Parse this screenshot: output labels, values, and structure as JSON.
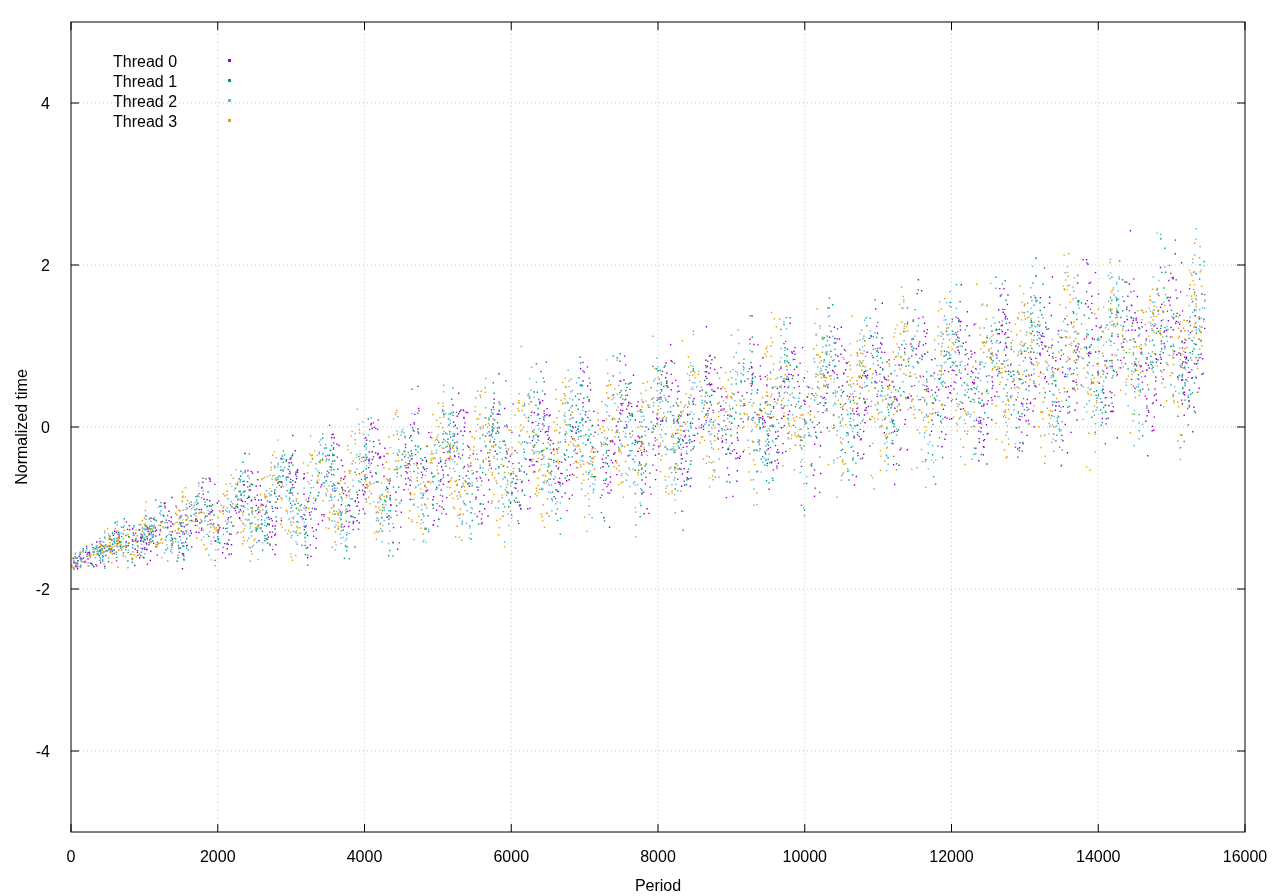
{
  "plot": {
    "x_axis": {
      "title": "Period",
      "ticks": [
        "0",
        "2000",
        "4000",
        "6000",
        "8000",
        "10000",
        "12000",
        "14000",
        "16000"
      ]
    },
    "y_axis": {
      "title": "Normalized time",
      "ticks": [
        "4",
        "2",
        "0",
        "-2",
        "-4"
      ]
    },
    "legend": [
      {
        "label": "Thread 0",
        "color": "#9400d3"
      },
      {
        "label": "Thread 1",
        "color": "#009e73"
      },
      {
        "label": "Thread 2",
        "color": "#56b4e9"
      },
      {
        "label": "Thread 3",
        "color": "#e69f00"
      }
    ]
  }
}
